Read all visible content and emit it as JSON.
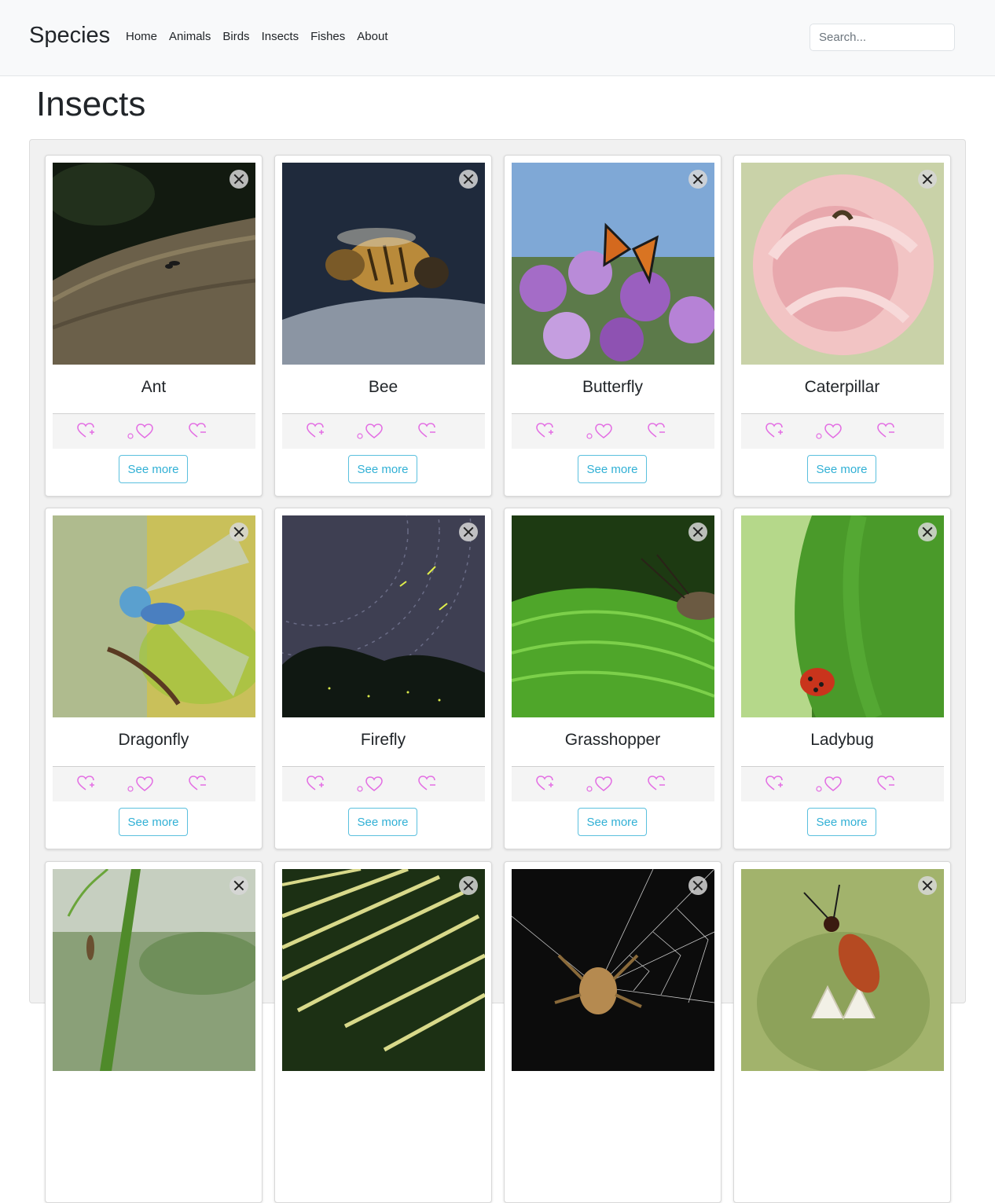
{
  "navbar": {
    "brand": "Species",
    "links": [
      "Home",
      "Animals",
      "Birds",
      "Insects",
      "Fishes",
      "About"
    ],
    "search_placeholder": "Search..."
  },
  "page": {
    "title": "Insects"
  },
  "cards": [
    {
      "name": "Ant",
      "image": "ant-photo"
    },
    {
      "name": "Bee",
      "image": "bee-photo"
    },
    {
      "name": "Butterfly",
      "image": "butterfly-photo"
    },
    {
      "name": "Caterpillar",
      "image": "caterpillar-photo"
    },
    {
      "name": "Dragonfly",
      "image": "dragonfly-photo"
    },
    {
      "name": "Firefly",
      "image": "firefly-photo"
    },
    {
      "name": "Grasshopper",
      "image": "grasshopper-photo"
    },
    {
      "name": "Ladybug",
      "image": "ladybug-photo"
    },
    {
      "name": "",
      "image": "mayfly-photo"
    },
    {
      "name": "",
      "image": "leaf-photo"
    },
    {
      "name": "",
      "image": "spider-photo"
    },
    {
      "name": "",
      "image": "beetle-photo"
    }
  ],
  "card_actions": {
    "see_more": "See more",
    "icon_color": "#e36ee3"
  },
  "colors": {
    "navbar_bg": "#f8f9fa",
    "button_border": "#5bc0de",
    "button_text": "#31b0d5"
  }
}
